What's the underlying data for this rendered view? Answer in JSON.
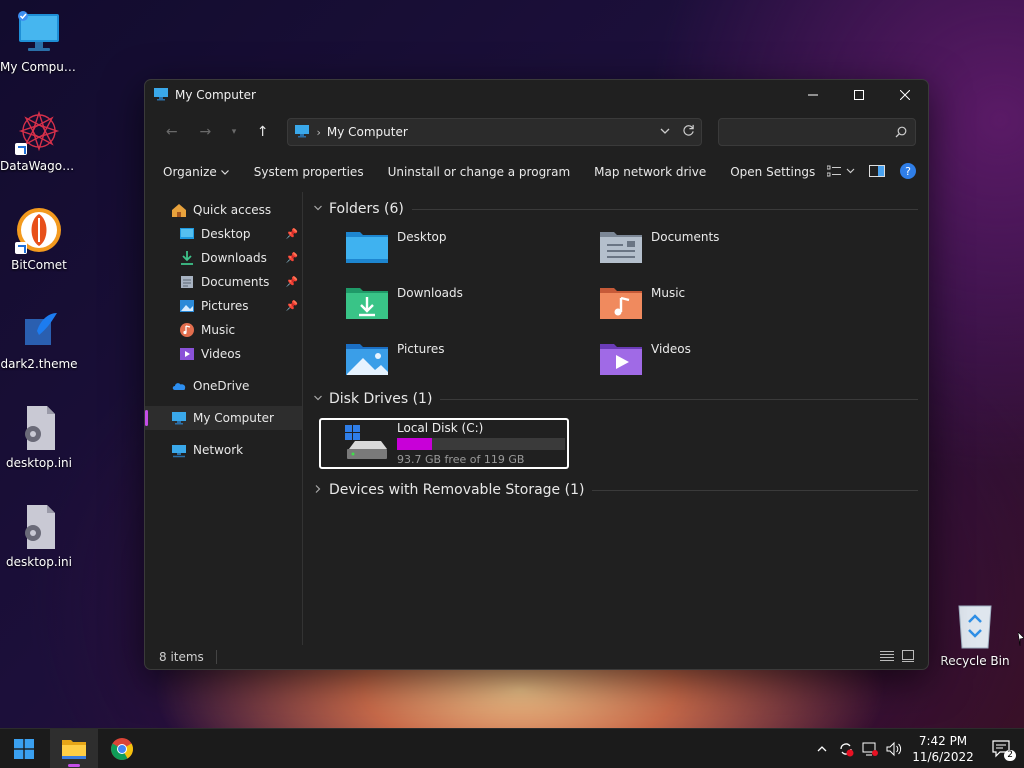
{
  "desktop": {
    "icons": [
      {
        "label": "My Computer",
        "icon": "computer-icon"
      },
      {
        "label": "DataWagon...",
        "icon": "datawagon-icon",
        "shortcut": true
      },
      {
        "label": "BitComet",
        "icon": "bitcomet-icon",
        "shortcut": true
      },
      {
        "label": "dark2.theme",
        "icon": "theme-file-icon"
      },
      {
        "label": "desktop.ini",
        "icon": "settings-file-icon"
      },
      {
        "label": "desktop.ini",
        "icon": "settings-file-icon"
      },
      {
        "label": "Recycle Bin",
        "icon": "recycle-bin-icon"
      }
    ]
  },
  "window": {
    "title": "My Computer",
    "address": {
      "crumb": "My Computer"
    },
    "search": {
      "placeholder": ""
    },
    "commands": [
      "Organize",
      "System properties",
      "Uninstall or change a program",
      "Map network drive",
      "Open Settings"
    ],
    "navpane": {
      "quick_access": "Quick access",
      "quick_items": [
        {
          "label": "Desktop",
          "pinned": true
        },
        {
          "label": "Downloads",
          "pinned": true
        },
        {
          "label": "Documents",
          "pinned": true
        },
        {
          "label": "Pictures",
          "pinned": true
        },
        {
          "label": "Music",
          "pinned": false
        },
        {
          "label": "Videos",
          "pinned": false
        }
      ],
      "onedrive": "OneDrive",
      "my_computer": "My Computer",
      "network": "Network"
    },
    "groups": {
      "folders": "Folders (6)",
      "folder_items": [
        "Desktop",
        "Documents",
        "Downloads",
        "Music",
        "Pictures",
        "Videos"
      ],
      "drives": "Disk Drives (1)",
      "drive": {
        "name": "Local Disk (C:)",
        "free_text": "93.7 GB free of 119 GB",
        "used_fraction": 0.21
      },
      "removable": "Devices with Removable Storage (1)"
    },
    "status": {
      "items": "8 items"
    }
  },
  "taskbar": {
    "time": "7:42 PM",
    "date": "11/6/2022",
    "notifications": "2"
  },
  "colors": {
    "accent": "#c54ee8",
    "drive_fill": "#c800d8",
    "window_bg": "#202020"
  }
}
